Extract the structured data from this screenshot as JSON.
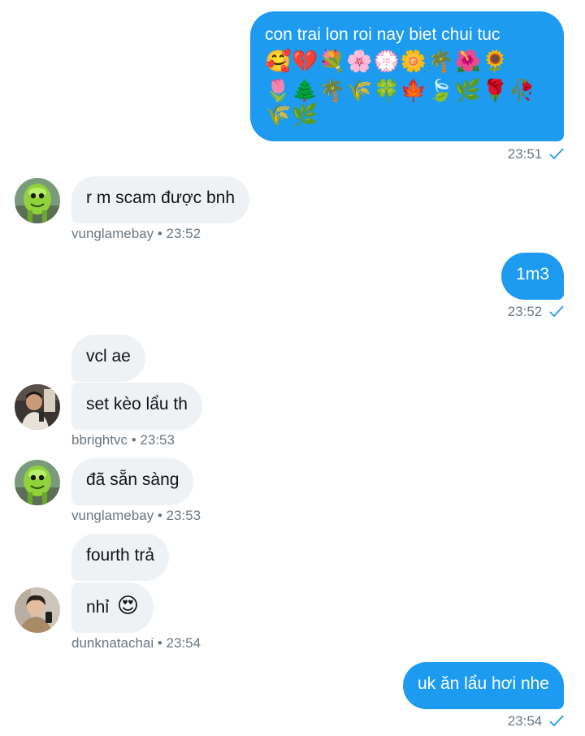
{
  "messages": {
    "m1": {
      "text": "con trai lon roi nay biet chui tuc",
      "emoji_row1": "🥰💔💐🌸💮🌼🌴🌺🌻",
      "emoji_row2": "🌷🌲🌴🌾🍀🍁🍃🌿🌹🥀",
      "emoji_row3": "🌾🌿",
      "time": "23:51"
    },
    "m2": {
      "text": "r m scam được bnh",
      "meta": "vunglamebay • 23:52"
    },
    "m3": {
      "text": "1m3",
      "time": "23:52"
    },
    "m4": {
      "text": "vcl ae"
    },
    "m5": {
      "text": "set kèo lẩu th",
      "meta": "bbrightvc • 23:53"
    },
    "m6": {
      "text": "đã sẵn sàng",
      "meta": "vunglamebay • 23:53"
    },
    "m7": {
      "text": "fourth trả"
    },
    "m8": {
      "text": "nhỉ",
      "emoji": "😍",
      "meta": "dunknatachai • 23:54"
    },
    "m9": {
      "text": "uk ăn lẩu hơi nhe",
      "time": "23:54"
    }
  },
  "colors": {
    "sent_bubble": "#1d9bf0",
    "recv_bubble": "#eff2f5",
    "meta_text": "#6b7782",
    "check": "#1d9bf0"
  },
  "icons": {
    "read_receipt": "check-icon"
  }
}
